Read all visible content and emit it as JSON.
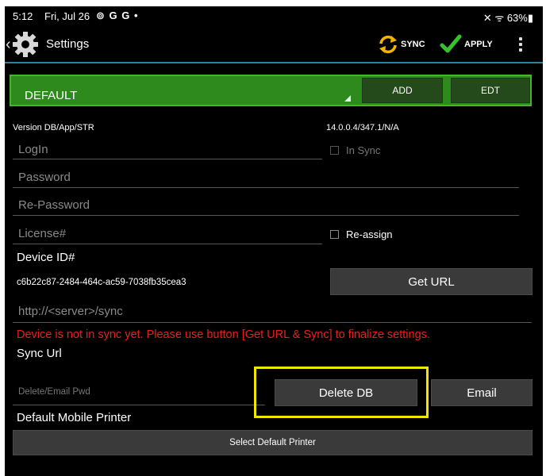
{
  "status_bar": {
    "time": "5:12",
    "date": "Fri, Jul 26",
    "left_icons": "⊚ G G •",
    "right": "✕ ᯤ 63%▮"
  },
  "action_bar": {
    "title": "Settings",
    "sync_label": "SYNC",
    "apply_label": "APPLY"
  },
  "profile": {
    "selected": "DEFAULT",
    "add_label": "ADD",
    "edit_label": "EDT"
  },
  "version": {
    "label": "Version DB/App/STR",
    "value": "14.0.0.4/347.1/N/A"
  },
  "form": {
    "login_placeholder": "LogIn",
    "in_sync_label": "In Sync",
    "password_placeholder": "Password",
    "repassword_placeholder": "Re-Password",
    "license_placeholder": "License#",
    "reassign_label": "Re-assign",
    "device_id_label": "Device ID#",
    "device_id_value": "c6b22c87-2484-464c-ac59-7038fb35cea3",
    "get_url_label": "Get URL",
    "sync_url_placeholder": "http://<server>/sync",
    "warning": "Device is not in sync yet. Please use button [Get URL & Sync] to finalize settings.",
    "sync_url_label": "Sync Url",
    "delete_pwd_placeholder": "Delete/Email Pwd",
    "delete_db_label": "Delete DB",
    "email_label": "Email",
    "printer_label": "Default Mobile Printer",
    "select_printer_label": "Select Default Printer"
  },
  "colors": {
    "accent_line": "#2f7fa8",
    "profile_green": "#2f8a1e",
    "warning_red": "#e8201c",
    "highlight_yellow": "#f2e600"
  }
}
